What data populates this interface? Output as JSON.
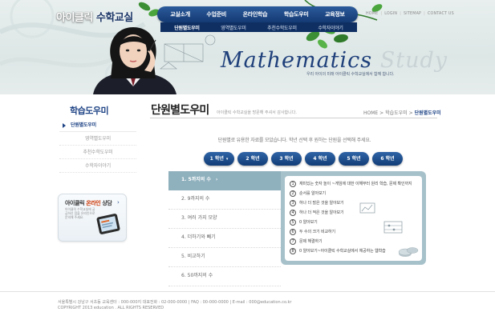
{
  "header": {
    "logo_main": "아이클릭",
    "logo_suffix": "수학교실",
    "gnb": [
      "교실소개",
      "수업준비",
      "온라인학습",
      "학습도우미",
      "교육정보"
    ],
    "lnb": [
      "단원별도우미",
      "영역별도우미",
      "추천수학도우미",
      "수학자이야기"
    ],
    "lnb_active_index": 0,
    "util": [
      "HOME",
      "LOGIN",
      "SITEMAP",
      "CONTACT US"
    ],
    "banner_title_main": "Mathematics",
    "banner_title_faded": "Study",
    "tagline": "우리 아이의 미래 아이클릭 수학교실에서 함께 합니다."
  },
  "sidebar": {
    "title": "학습도우미",
    "items": [
      {
        "label": "단원별도우미",
        "active": true
      },
      {
        "label": "영역별도우미",
        "active": false
      },
      {
        "label": "추천수학도우미",
        "active": false
      },
      {
        "label": "수학자이야기",
        "active": false
      }
    ],
    "banner": {
      "title_prefix": "아이클릭 ",
      "title_highlight": "온라인",
      "title_suffix": " 상담",
      "arrow": "›",
      "desc": "아이클릭 수학교실에 궁금하신 점을 온라인으로 문의해 주세요."
    }
  },
  "content": {
    "title": "단원별도우미",
    "subtitle": "아이클릭 수학교실을 방문해 주셔서 감사합니다.",
    "breadcrumb": {
      "home": "HOME",
      "sep": ">",
      "parent": "학습도우미",
      "current": "단원별도우미"
    },
    "intro": "단원별로 유용한 자료를 모았습니다. 학년 선택 후 원하는 단원을 선택해 주세요.",
    "grades": [
      "1 학년",
      "2 학년",
      "3 학년",
      "4 학년",
      "5 학년",
      "6 학년"
    ],
    "active_grade_caret": "▾",
    "units": [
      {
        "label": "1. 5까지의 수",
        "active": true
      },
      {
        "label": "2. 9까지의 수",
        "active": false
      },
      {
        "label": "3. 여러 가지 모양",
        "active": false
      },
      {
        "label": "4. 더하기와 빼기",
        "active": false
      },
      {
        "label": "5. 비교하기",
        "active": false
      },
      {
        "label": "6. 50까지의 수",
        "active": false
      }
    ],
    "unit_chevron": "›",
    "items": [
      {
        "num": "1",
        "text": "재미있는 숫자 놀이 ~게임에 대한 이해부터 원리 학습, 문제 확인까지"
      },
      {
        "num": "2",
        "text": "순서를 알아보기"
      },
      {
        "num": "3",
        "text": "하나 더 많은 것을 알아보기"
      },
      {
        "num": "4",
        "text": "하나 더 적은 것을 알아보기"
      },
      {
        "num": "5",
        "text": "0 알아보기"
      },
      {
        "num": "6",
        "text": "두 수의 크기 비교하기"
      },
      {
        "num": "7",
        "text": "문제 해결하기"
      },
      {
        "num": "8",
        "text": "0 알아보기~아이클릭 수학교실에서 체공하는 웹학습"
      }
    ]
  },
  "footer": {
    "line1": "서울특별시 강남구 서초동 교육센터 : 000-000지   대표전화 : 02-000-0000   |   FAQ : 00-000-0000   |   E-mail : 000@education.co.kr",
    "line2": "COPYRIGHT 2013 education . ALL RIGHTS RESERVED"
  },
  "colors": {
    "primary_navy": "#1e4385",
    "panel_teal": "#a7c1ca",
    "unit_active": "#8fb0bd"
  }
}
